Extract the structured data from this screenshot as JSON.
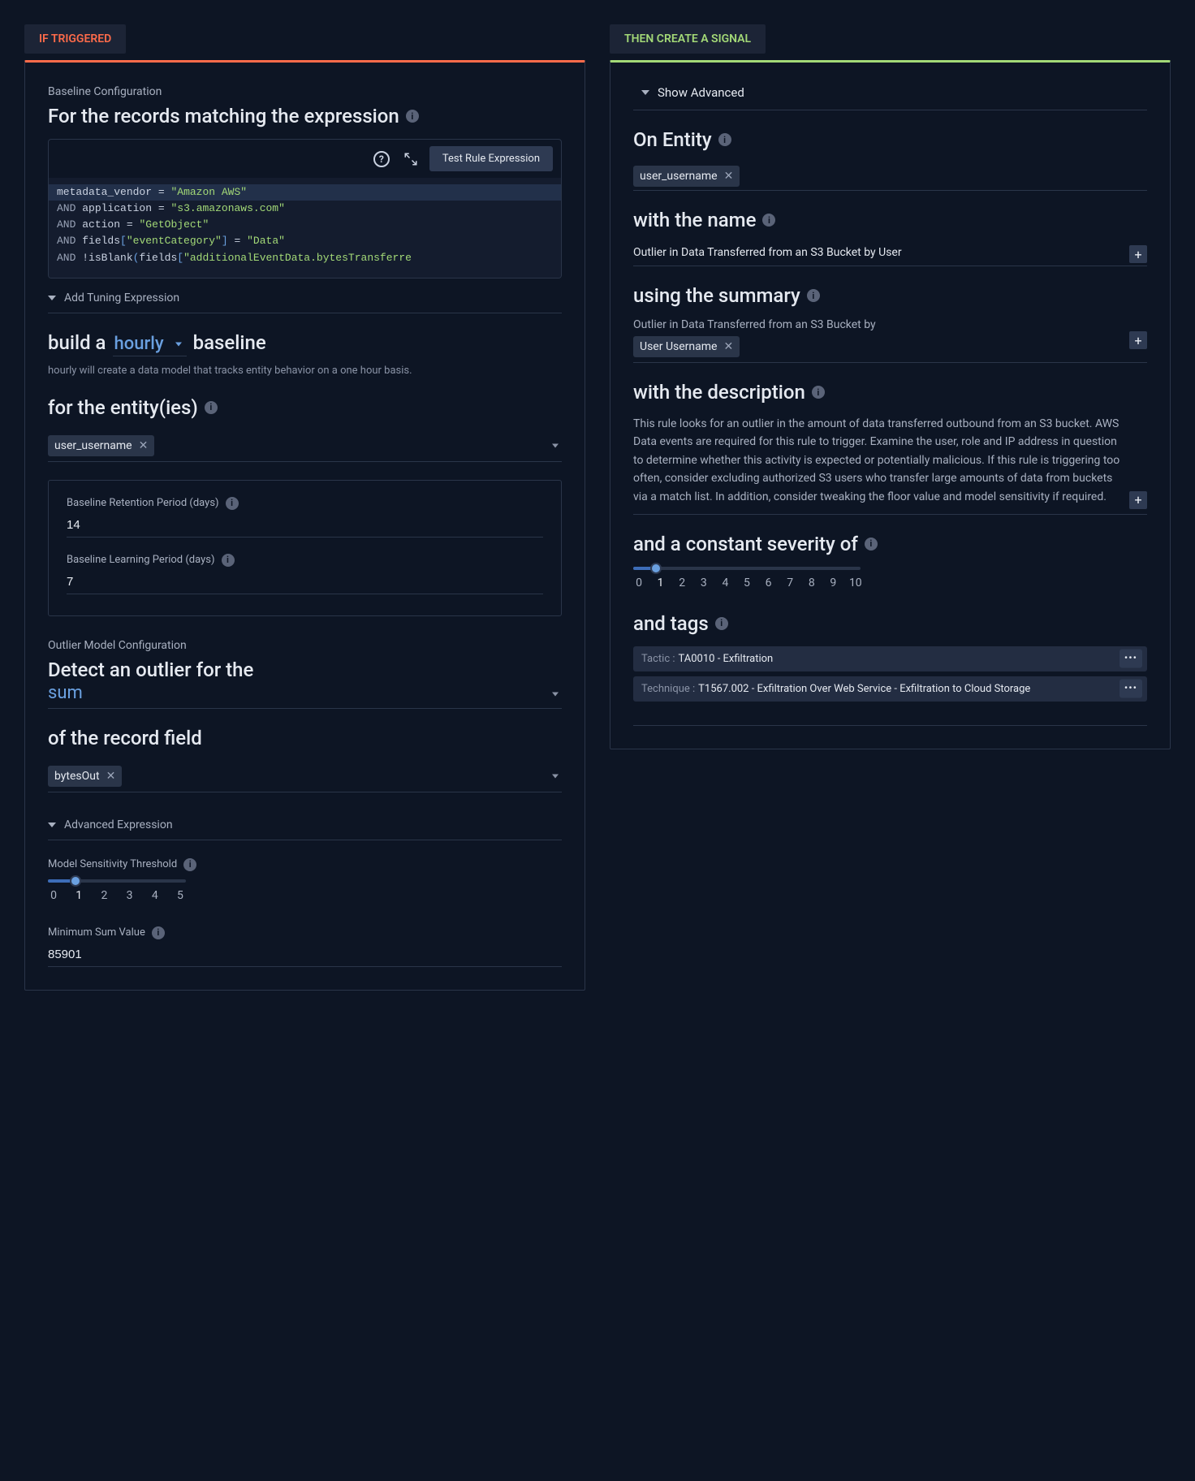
{
  "left": {
    "tab_label": "IF TRIGGERED",
    "baseline_config_label": "Baseline Configuration",
    "records_heading": "For the records matching the expression",
    "test_btn": "Test Rule Expression",
    "code": {
      "l1_a": "metadata_vendor",
      "l1_b": "\"Amazon AWS\"",
      "l2_a": "application",
      "l2_b": "\"s3.amazonaws.com\"",
      "l3_a": "action",
      "l3_b": "\"GetObject\"",
      "l4_a": "fields",
      "l4_k": "\"eventCategory\"",
      "l4_b": "\"Data\"",
      "l5_a": "!isBlank",
      "l5_b": "fields",
      "l5_k": "\"additionalEventData.bytesTransferre",
      "and": "AND",
      "eq": "="
    },
    "add_tuning": "Add Tuning Expression",
    "build_a": "build a",
    "interval": "hourly",
    "baseline_word": "baseline",
    "interval_helper": "hourly will create a data model that tracks entity behavior on a one hour basis.",
    "entities_heading": "for the entity(ies)",
    "entity_chip": "user_username",
    "retention_label": "Baseline Retention Period (days)",
    "retention_value": "14",
    "learning_label": "Baseline Learning Period (days)",
    "learning_value": "7",
    "outlier_config_label": "Outlier Model Configuration",
    "detect_heading": "Detect an outlier for the",
    "agg": "sum",
    "of_field_heading": "of the record field",
    "field_chip": "bytesOut",
    "adv_expr": "Advanced Expression",
    "sensitivity_label": "Model Sensitivity Threshold",
    "sensitivity_scale": [
      "0",
      "1",
      "2",
      "3",
      "4",
      "5"
    ],
    "sensitivity_value": 1,
    "min_sum_label": "Minimum Sum Value",
    "min_sum_value": "85901"
  },
  "right": {
    "tab_label": "THEN CREATE A SIGNAL",
    "show_advanced": "Show Advanced",
    "on_entity": "On Entity",
    "entity_chip": "user_username",
    "with_name": "with the name",
    "name_value": "Outlier in Data Transferred from an S3 Bucket by User",
    "using_summary": "using the summary",
    "summary_prefix": "Outlier in Data Transferred from an S3 Bucket by",
    "summary_chip": "User Username",
    "with_description": "with the description",
    "description": "This rule looks for an outlier in the amount of data transferred outbound from an S3 bucket. AWS Data events are required for this rule to trigger. Examine the user, role and IP address in question to determine whether this activity is expected or potentially malicious. If this rule is triggering too often, consider excluding authorized S3 users who transfer large amounts of data from buckets via a match list. In addition, consider tweaking the floor value and model sensitivity if required.",
    "severity_heading": "and a constant severity of",
    "severity_scale": [
      "0",
      "1",
      "2",
      "3",
      "4",
      "5",
      "6",
      "7",
      "8",
      "9",
      "10"
    ],
    "severity_value": 1,
    "tags_heading": "and tags",
    "tags": [
      {
        "k": "Tactic :",
        "v": "TA0010 - Exfiltration"
      },
      {
        "k": "Technique :",
        "v": "T1567.002 - Exfiltration Over Web Service - Exfiltration to Cloud Storage"
      }
    ]
  }
}
